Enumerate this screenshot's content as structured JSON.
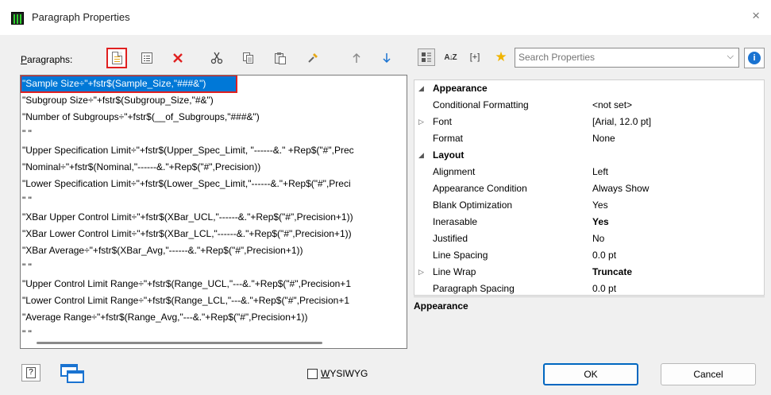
{
  "window": {
    "title": "Paragraph Properties",
    "close_glyph": "×"
  },
  "paragraphs_label": {
    "accel": "P",
    "rest": "aragraphs:"
  },
  "toolbar_icons": [
    "new-paragraph-icon",
    "properties-icon",
    "delete-icon",
    "cut-icon",
    "copy-icon",
    "paste-icon",
    "format-painter-icon",
    "move-up-icon",
    "move-down-icon"
  ],
  "paragraphs": [
    "\"Sample Size÷\"+fstr$(Sample_Size,\"###&\")",
    "\"Subgroup Size÷\"+fstr$(Subgroup_Size,\"#&\")",
    "\"Number of Subgroups÷\"+fstr$(__of_Subgroups,\"###&\")",
    "\" \"",
    "\"Upper Specification Limit÷\"+fstr$(Upper_Spec_Limit, \"------&.\" +Rep$(\"#\",Prec",
    "\"Nominal÷\"+fstr$(Nominal,\"------&.\"+Rep$(\"#\",Precision))",
    "\"Lower Specification Limit÷\"+fstr$(Lower_Spec_Limit,\"------&.\"+Rep$(\"#\",Preci",
    "\" \"",
    "\"XBar Upper Control Limit÷\"+fstr$(XBar_UCL,\"------&.\"+Rep$(\"#\",Precision+1))",
    "\"XBar Lower Control Limit÷\"+fstr$(XBar_LCL,\"------&.\"+Rep$(\"#\",Precision+1))",
    "\"XBar Average÷\"+fstr$(XBar_Avg,\"------&.\"+Rep$(\"#\",Precision+1))",
    "\" \"",
    "\"Upper Control Limit Range÷\"+fstr$(Range_UCL,\"---&.\"+Rep$(\"#\",Precision+1",
    "\"Lower Control Limit Range÷\"+fstr$(Range_LCL,\"---&.\"+Rep$(\"#\",Precision+1",
    "\"Average Range÷\"+fstr$(Range_Avg,\"---&.\"+Rep$(\"#\",Precision+1))",
    "\" \"",
    "---"
  ],
  "selected_paragraph_index": 0,
  "property_toolbar": {
    "categorized_icon": "categorized-icon",
    "sort_icon": "alphabetical-sort-icon",
    "sort_label": "A↓Z",
    "expand_label": "[+]",
    "favorite_icon": "star-icon"
  },
  "search": {
    "placeholder": "Search Properties",
    "value": ""
  },
  "info_glyph": "i",
  "properties": [
    {
      "type": "category",
      "name": "Appearance",
      "expander": "◢"
    },
    {
      "type": "prop",
      "name": "Conditional Formatting",
      "value": "<not set>",
      "bold": false
    },
    {
      "type": "prop",
      "name": "Font",
      "value": "[Arial, 12.0 pt]",
      "bold": false,
      "expander": "▷"
    },
    {
      "type": "prop",
      "name": "Format",
      "value": "None",
      "bold": false
    },
    {
      "type": "category",
      "name": "Layout",
      "expander": "◢"
    },
    {
      "type": "prop",
      "name": "Alignment",
      "value": "Left",
      "bold": false
    },
    {
      "type": "prop",
      "name": "Appearance Condition",
      "value": "Always Show",
      "bold": false
    },
    {
      "type": "prop",
      "name": "Blank Optimization",
      "value": "Yes",
      "bold": false
    },
    {
      "type": "prop",
      "name": "Inerasable",
      "value": "Yes",
      "bold": true
    },
    {
      "type": "prop",
      "name": "Justified",
      "value": "No",
      "bold": false
    },
    {
      "type": "prop",
      "name": "Line Spacing",
      "value": "0.0 pt",
      "bold": false
    },
    {
      "type": "prop",
      "name": "Line Wrap",
      "value": "Truncate",
      "bold": true,
      "expander": "▷"
    },
    {
      "type": "prop",
      "name": "Paragraph Spacing",
      "value": "0.0 pt",
      "bold": false
    }
  ],
  "description": {
    "title": "Appearance"
  },
  "footer": {
    "help_glyph": "?",
    "wysiwyg": {
      "accel": "W",
      "rest": "YSIWYG",
      "checked": false
    },
    "ok_label": "OK",
    "cancel_label": "Cancel"
  },
  "colors": {
    "selection": "#0078d7",
    "highlight": "#e02020",
    "accent": "#0067c0"
  }
}
